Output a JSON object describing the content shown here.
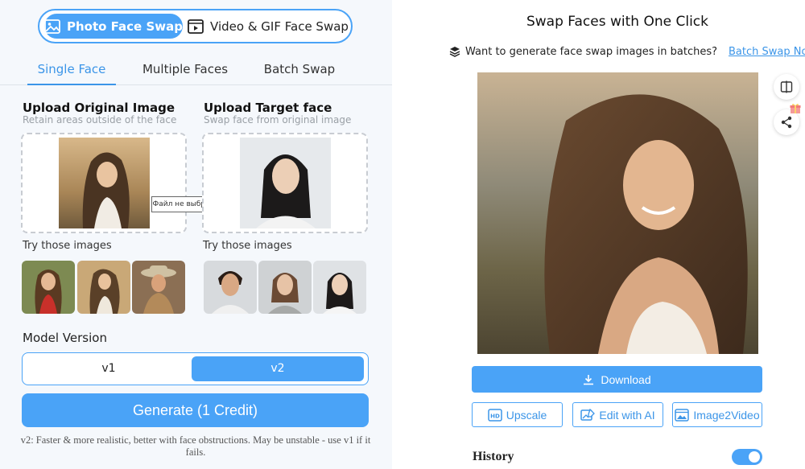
{
  "modes": {
    "photo_label": "Photo Face Swap",
    "video_label": "Video & GIF Face Swap",
    "photo_icon": "image-icon",
    "video_icon": "film-icon"
  },
  "tabs": [
    "Single Face",
    "Multiple Faces",
    "Batch Swap"
  ],
  "original": {
    "title": "Upload Original Image",
    "subtitle": "Retain areas outside of the face",
    "file_tooltip": "Файл не выбран",
    "try_label": "Try those images"
  },
  "target": {
    "title": "Upload Target face",
    "subtitle": "Swap face from original image",
    "try_label": "Try those images"
  },
  "model": {
    "label": "Model Version",
    "options": [
      "v1",
      "v2"
    ],
    "selected": "v2"
  },
  "generate_label": "Generate (1 Credit)",
  "note": "v2: Faster & more realistic, better with face obstructions. May be unstable - use v1 if it fails.",
  "result": {
    "title": "Swap Faces with One Click",
    "batch_prompt": "Want to generate face swap images in batches?",
    "batch_link": "Batch Swap Now",
    "download_label": "Download",
    "upscale_label": "Upscale",
    "edit_label": "Edit with AI",
    "image2video_label": "Image2Video",
    "history_label": "History",
    "history_enabled": true
  },
  "colors": {
    "accent": "#4aa3f7",
    "link": "#3b95e8",
    "panel_bg": "#f5f8fc"
  }
}
